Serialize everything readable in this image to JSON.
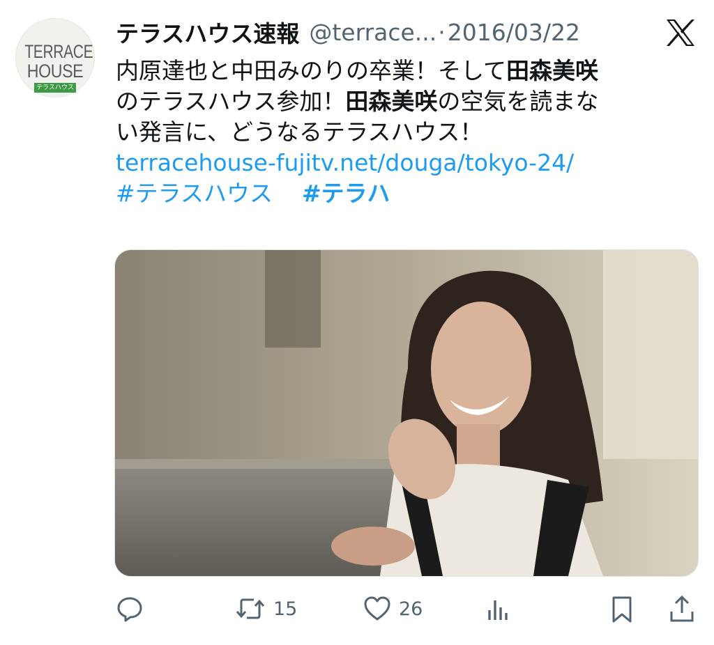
{
  "avatar": {
    "line1": "TERRACE",
    "line2": "HOUSE",
    "strip": "テラスハウス"
  },
  "tweet": {
    "name": "テラスハウス速報",
    "handle": "@terrace...",
    "separator": "·",
    "date": "2016/03/22",
    "line1_part1": "内原達也と中田みのりの卒業！そして",
    "line1_bold": "田森美咲",
    "line2_part1": "のテラスハウス参加！",
    "line2_bold": "田森美咲",
    "line2_part2": "の空気を読まな",
    "line3": "い発言に、どうなるテラスハウス！",
    "link": "terracehouse-fujitv.net/douga/tokyo-24/",
    "hashtag1": "#テラスハウス",
    "hashtag2": "#テラハ"
  },
  "actions": {
    "retweet_count": "15",
    "like_count": "26"
  },
  "colors": {
    "link": "#1d9bf0",
    "muted": "#536471",
    "text": "#0f1419"
  }
}
